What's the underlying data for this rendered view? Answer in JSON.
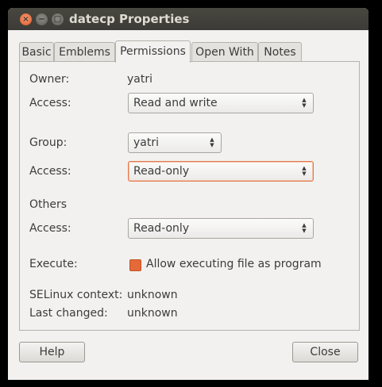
{
  "window": {
    "title": "datecp Properties",
    "close_glyph": "×",
    "minimize_glyph": "−",
    "maximize_glyph": "□"
  },
  "tabs": [
    {
      "label": "Basic"
    },
    {
      "label": "Emblems"
    },
    {
      "label": "Permissions",
      "active": true
    },
    {
      "label": "Open With"
    },
    {
      "label": "Notes"
    }
  ],
  "permissions": {
    "owner_label": "Owner:",
    "owner_value": "yatri",
    "owner_access_label": "Access:",
    "owner_access_value": "Read and write",
    "group_label": "Group:",
    "group_value": "yatri",
    "group_access_label": "Access:",
    "group_access_value": "Read-only",
    "others_label": "Others",
    "others_access_label": "Access:",
    "others_access_value": "Read-only",
    "execute_label": "Execute:",
    "execute_checkbox_label": "Allow executing file as program",
    "selinux_label": "SELinux context:",
    "selinux_value": "unknown",
    "last_changed_label": "Last changed:",
    "last_changed_value": "unknown"
  },
  "buttons": {
    "help": "Help",
    "close": "Close"
  },
  "colors": {
    "accent": "#e1592a",
    "titlebar": "#3c3b37",
    "background": "#f2f1f0"
  }
}
